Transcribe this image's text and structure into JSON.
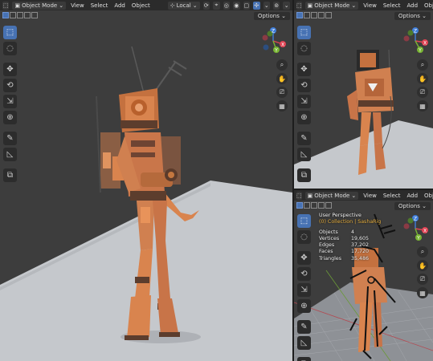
{
  "header": {
    "mode_label": "Object Mode",
    "menus": [
      "View",
      "Select",
      "Add",
      "Object"
    ],
    "transform_orientation": "Local",
    "options_label": "Options"
  },
  "stats": {
    "view_name": "User Perspective",
    "collection": "(0) Collection | SashaRig",
    "rows": [
      {
        "label": "Objects",
        "value": "4"
      },
      {
        "label": "Vertices",
        "value": "19,605"
      },
      {
        "label": "Edges",
        "value": "37,202"
      },
      {
        "label": "Faces",
        "value": "17,720"
      },
      {
        "label": "Triangles",
        "value": "35,486"
      }
    ]
  },
  "gizmo_axes": {
    "x": "X",
    "y": "Y",
    "z": "Z"
  },
  "colors": {
    "header_bg": "#2b2b2b",
    "viewport_bg": "#3d3d3d",
    "active_tool": "#4772b3",
    "character_orange": "#d9844e",
    "axis_x": "#e04354",
    "axis_y": "#79b533",
    "axis_z": "#3f7dd8",
    "collection_text": "#e8b040"
  },
  "icons": {
    "tools": [
      "select-box-icon",
      "cursor-icon",
      "move-icon",
      "rotate-icon",
      "scale-icon",
      "transform-icon",
      "annotate-icon",
      "measure-icon",
      "add-cube-icon"
    ],
    "navigation": [
      "zoom-icon",
      "hand-pan-icon",
      "camera-icon",
      "grid-perspective-icon"
    ]
  }
}
